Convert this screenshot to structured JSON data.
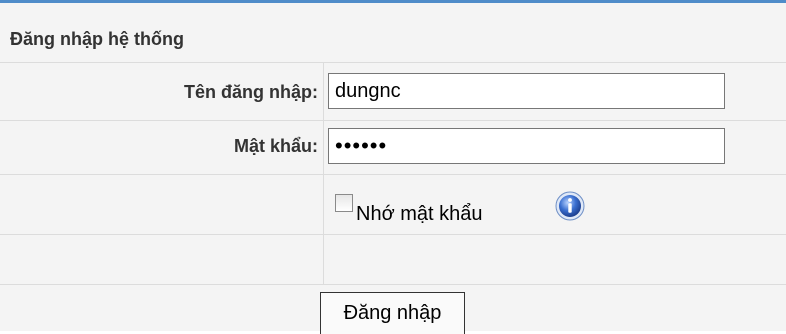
{
  "form": {
    "title": "Đăng nhập hệ thống",
    "username_label": "Tên đăng nhập:",
    "username_value": "dungnc",
    "password_label": "Mật khẩu:",
    "password_value": "dungnc",
    "remember_label": "Nhớ mật khẩu",
    "remember_checked": false,
    "submit_label": "Đăng nhập"
  },
  "icons": {
    "info": "info-icon"
  },
  "colors": {
    "accent_border": "#4f8cc9",
    "row_background": "#f4f4f4",
    "info_icon": "#3a6fd0"
  }
}
